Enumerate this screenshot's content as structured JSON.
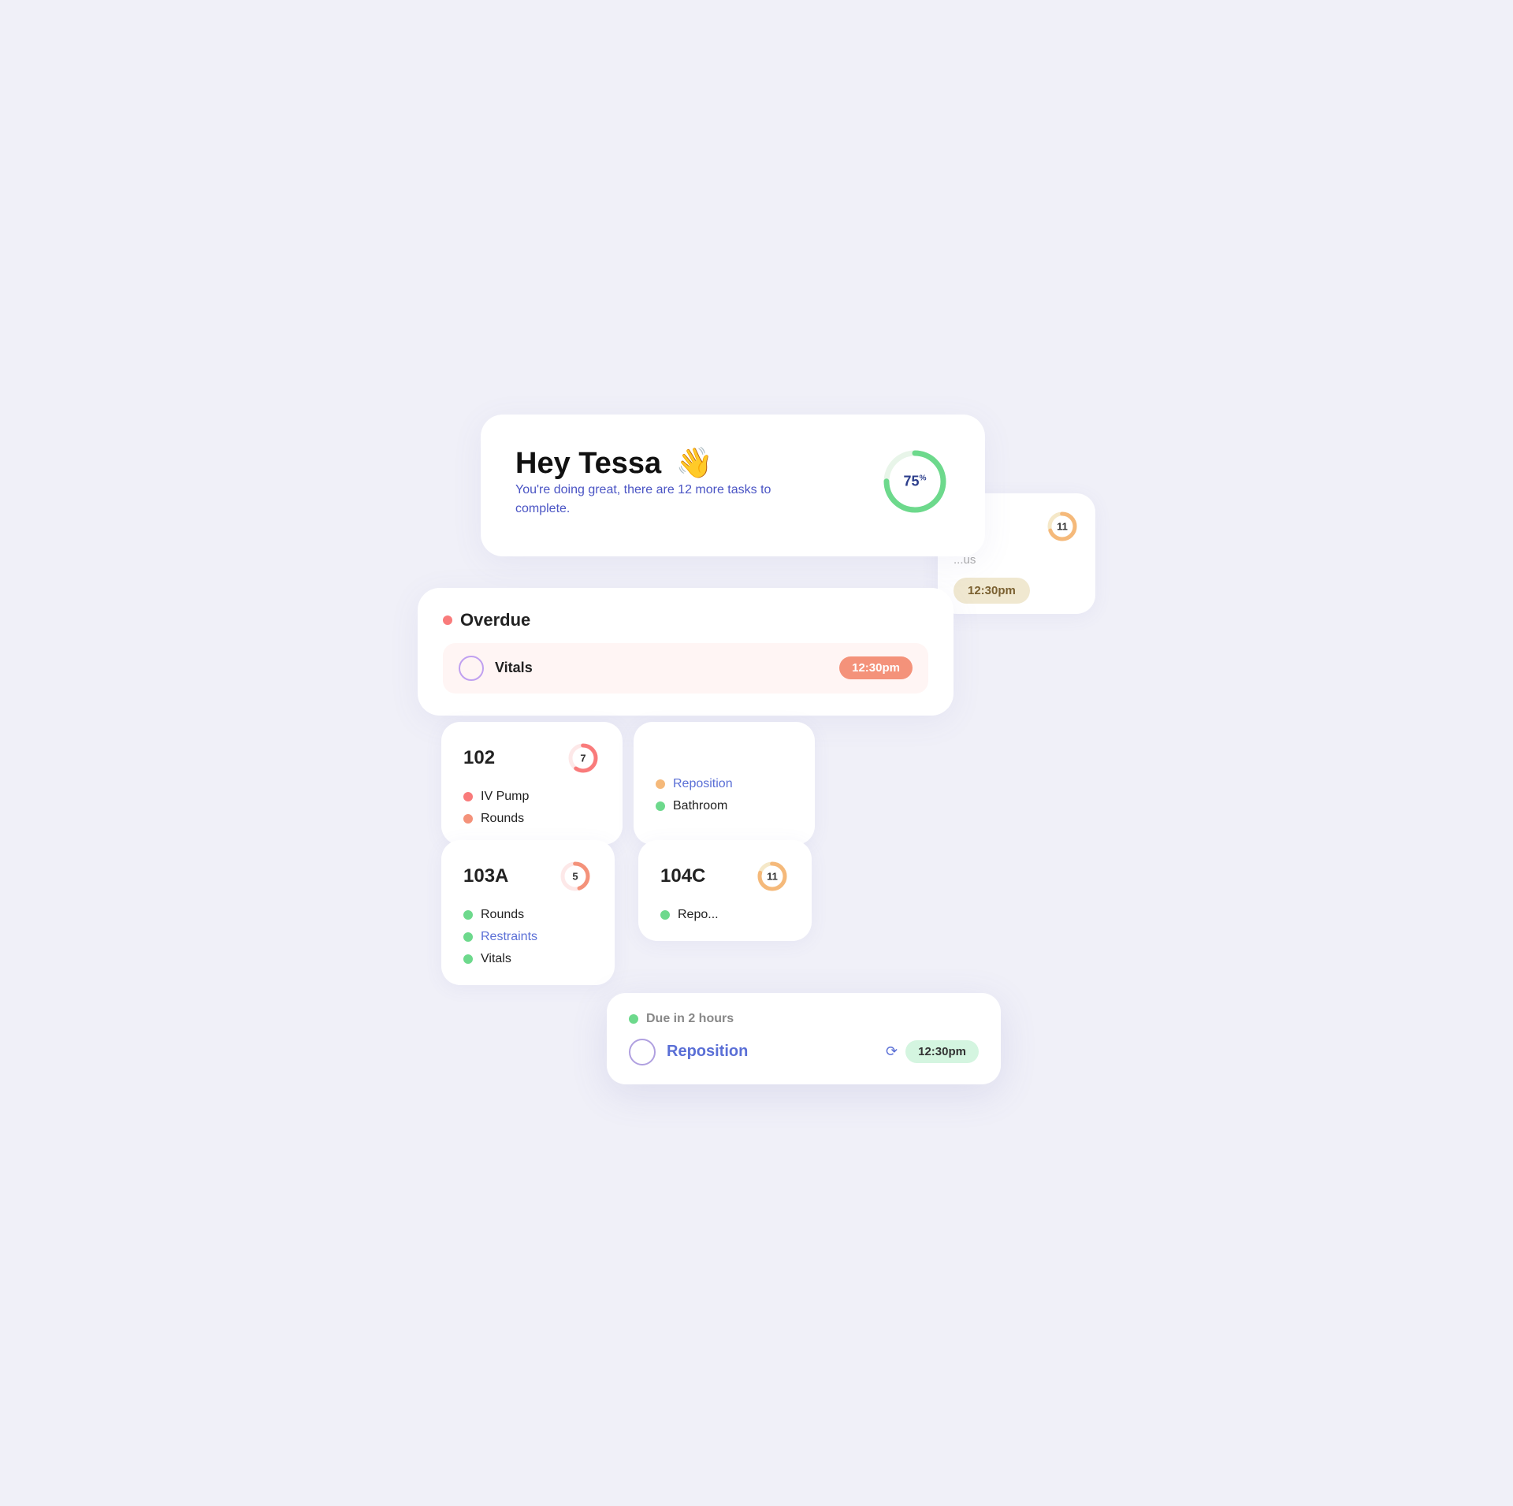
{
  "greeting": {
    "title": "Hey Tessa",
    "emoji": "👋",
    "subtitle": "You're doing great, there are 12 more tasks to complete.",
    "progress_percent": 75,
    "progress_label": "75",
    "progress_sup": "%"
  },
  "overdue": {
    "label": "Overdue",
    "task": {
      "name": "Vitals",
      "time": "12:30pm"
    }
  },
  "rooms": [
    {
      "id": "room-102",
      "number": "102",
      "count": 7,
      "tasks": [
        {
          "name": "IV Pump",
          "type": "red",
          "link": false
        },
        {
          "name": "Rounds",
          "type": "salmon",
          "link": false
        },
        {
          "name": "Reposition",
          "type": "orange",
          "link": true
        },
        {
          "name": "Bathroom",
          "type": "green",
          "link": false
        }
      ]
    },
    {
      "id": "room-103a",
      "number": "103A",
      "count": 5,
      "tasks": [
        {
          "name": "Rounds",
          "type": "green",
          "link": false
        },
        {
          "name": "Restraints",
          "type": "green",
          "link": true
        },
        {
          "name": "Vitals",
          "type": "green",
          "link": false
        }
      ]
    },
    {
      "id": "room-104c",
      "number": "104C",
      "count": 11,
      "tasks": [
        {
          "name": "Reposition",
          "type": "green",
          "link": false
        }
      ]
    }
  ],
  "bg_card": {
    "count": 11,
    "time_badge": "12:30pm"
  },
  "popup": {
    "due_label": "Due in 2 hours",
    "task_name": "Reposition",
    "time": "12:30pm"
  },
  "colors": {
    "accent": "#5a6fd6",
    "red": "#f97b7b",
    "orange": "#f5b97a",
    "green": "#6dd98c",
    "salmon": "#f4927a",
    "progress_track": "#e8f5e9",
    "progress_fill": "#6dd98c"
  }
}
